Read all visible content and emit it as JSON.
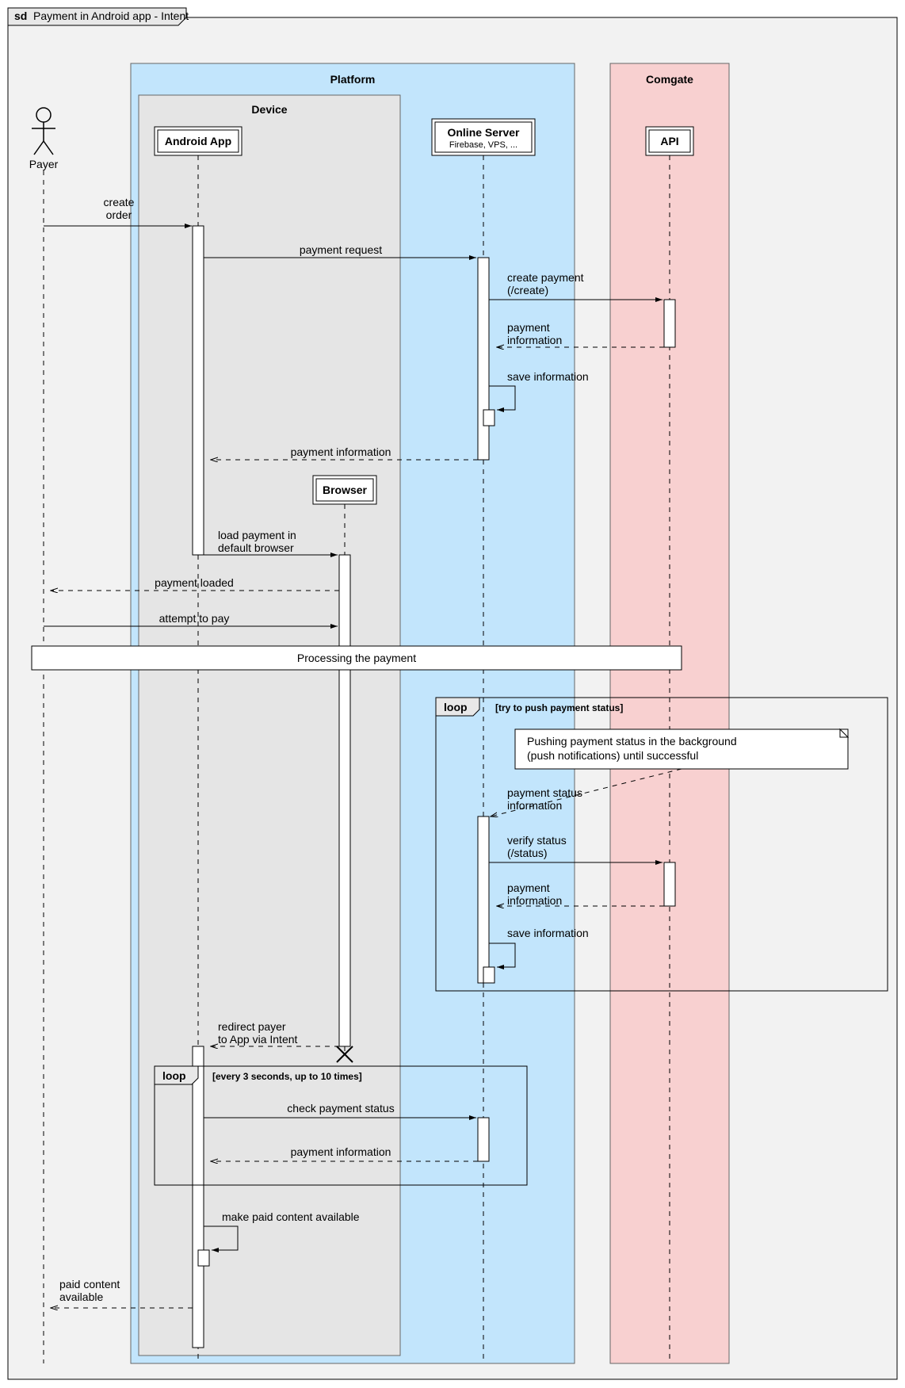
{
  "title_prefix": "sd",
  "title": "Payment in Android app - Intent",
  "participants": {
    "payer": "Payer",
    "android_app": "Android App",
    "browser": "Browser",
    "online_server": "Online Server",
    "online_server_sub": "Firebase, VPS, ...",
    "api": "API"
  },
  "groups": {
    "platform": "Platform",
    "device": "Device",
    "comgate": "Comgate"
  },
  "messages": {
    "create_order": "create\norder",
    "payment_request": "payment request",
    "create_payment": "create payment\n(/create)",
    "payment_information": "payment\ninformation",
    "save_information": "save information",
    "payment_information_2": "payment information",
    "load_payment": "load payment in\ndefault browser",
    "payment_loaded": "payment loaded",
    "attempt_to_pay": "attempt to pay",
    "processing": "Processing the payment",
    "payment_status_info": "payment status\ninformation",
    "verify_status": "verify status\n(/status)",
    "payment_information_3": "payment\ninformation",
    "save_information_2": "save information",
    "redirect_payer": "redirect payer\nto App via Intent",
    "check_payment_status": "check payment status",
    "payment_information_4": "payment information",
    "make_paid": "make paid content available",
    "paid_content": "paid content\navailable"
  },
  "loops": {
    "loop1_label": "loop",
    "loop1_condition": "[try to push payment status]",
    "loop2_label": "loop",
    "loop2_condition": "[every 3 seconds, up to 10 times]"
  },
  "note": "Pushing payment status in the background\n(push notifications) until successful"
}
